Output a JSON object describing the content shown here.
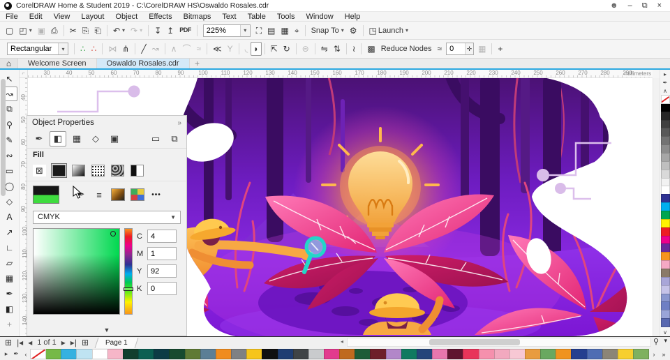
{
  "titlebar": {
    "title": "CorelDRAW Home & Student 2019 - C:\\CorelDRAW HS\\Oswaldo Rosales.cdr",
    "controls": {
      "account": "☻",
      "minimize": "–",
      "restore": "⧉",
      "close": "×"
    }
  },
  "menu": {
    "items": [
      "File",
      "Edit",
      "View",
      "Layout",
      "Object",
      "Effects",
      "Bitmaps",
      "Text",
      "Table",
      "Tools",
      "Window",
      "Help"
    ]
  },
  "toolbar": {
    "zoom_level": "225%",
    "left_buttons": [
      {
        "name": "new-document-button",
        "glyph": "▢"
      },
      {
        "name": "open-button",
        "glyph": "◰",
        "caret": true
      },
      {
        "name": "save-button",
        "glyph": "▣",
        "disabled": true
      },
      {
        "name": "print-button",
        "glyph": "⎙"
      },
      {
        "sep": true
      },
      {
        "name": "cut-button",
        "glyph": "✂"
      },
      {
        "name": "copy-button",
        "glyph": "⎘"
      },
      {
        "name": "paste-button",
        "glyph": "⎗"
      },
      {
        "sep": true
      },
      {
        "name": "undo-button",
        "glyph": "↶",
        "caret": true
      },
      {
        "name": "redo-button",
        "glyph": "↷",
        "caret": true,
        "disabled": true
      },
      {
        "sep": true
      },
      {
        "name": "import-button",
        "glyph": "↧"
      },
      {
        "name": "export-button",
        "glyph": "↥"
      },
      {
        "name": "publish-pdf-button",
        "glyph": "PDF",
        "text": true
      },
      {
        "sep": true
      }
    ],
    "right_buttons": [
      {
        "name": "full-screen-preview-button",
        "glyph": "⛶"
      },
      {
        "name": "show-rulers-button",
        "glyph": "▤"
      },
      {
        "name": "show-grid-button",
        "glyph": "▦"
      },
      {
        "name": "snap-off-button",
        "glyph": "⌖"
      },
      {
        "sep": true
      },
      {
        "name": "snap-to-dropdown",
        "label": "Snap To",
        "caret": true
      },
      {
        "name": "options-button",
        "glyph": "⚙"
      },
      {
        "sep": true
      },
      {
        "name": "launch-dropdown",
        "glyph": "◳",
        "label": "Launch",
        "caret": true
      }
    ]
  },
  "property_bar": {
    "shape_mode": "Rectangular",
    "smoothness_value": "0",
    "buttons": [
      {
        "name": "add-nodes-button",
        "glyph": "∴",
        "color": "#2e9e3f"
      },
      {
        "name": "delete-nodes-button",
        "glyph": "∴",
        "color": "#d23b2e"
      },
      {
        "sep": true
      },
      {
        "name": "join-nodes-button",
        "glyph": "⋈",
        "disabled": true
      },
      {
        "name": "break-nodes-button",
        "glyph": "⋔"
      },
      {
        "sep": true
      },
      {
        "name": "convert-to-line-button",
        "glyph": "╱"
      },
      {
        "name": "convert-to-curve-button",
        "glyph": "↝",
        "disabled": true
      },
      {
        "sep": true
      },
      {
        "name": "cusp-node-button",
        "glyph": "∧",
        "disabled": true
      },
      {
        "name": "smooth-node-button",
        "glyph": "⌒",
        "disabled": true
      },
      {
        "name": "symmetrical-node-button",
        "glyph": "≈",
        "disabled": true
      },
      {
        "sep": true
      },
      {
        "name": "reverse-direction-button",
        "glyph": "≪"
      },
      {
        "name": "extract-subpath-button",
        "glyph": "Y",
        "disabled": true
      },
      {
        "sep": true
      },
      {
        "name": "extend-curve-button",
        "glyph": "◟",
        "disabled": true
      },
      {
        "name": "close-curve-button",
        "glyph": "◗",
        "boxed": true
      },
      {
        "sep": true
      },
      {
        "name": "stretch-nodes-button",
        "glyph": "⇱"
      },
      {
        "name": "rotate-nodes-button",
        "glyph": "↻"
      },
      {
        "sep": true
      },
      {
        "name": "align-nodes-button",
        "glyph": "⊜",
        "disabled": true
      },
      {
        "sep": true
      },
      {
        "name": "reflect-horizontally-button",
        "glyph": "⇋"
      },
      {
        "name": "reflect-vertically-button",
        "glyph": "⇅"
      },
      {
        "sep": true
      },
      {
        "name": "elastic-mode-button",
        "glyph": "≀"
      },
      {
        "sep": true
      },
      {
        "name": "select-all-nodes-button",
        "glyph": "▩"
      },
      {
        "name": "reduce-nodes-button",
        "label": "Reduce Nodes"
      },
      {
        "name": "curve-smoothness-icon",
        "glyph": "≈"
      }
    ],
    "tail_buttons": [
      {
        "name": "snap-grid-button",
        "glyph": "▦",
        "disabled": true
      },
      {
        "sep": true
      },
      {
        "name": "customize-toolbar-button",
        "glyph": "+"
      }
    ]
  },
  "document_tabs": {
    "home_icon": "⌂",
    "tabs": [
      {
        "label": "Welcome Screen",
        "active": false
      },
      {
        "label": "Oswaldo Rosales.cdr",
        "active": true
      }
    ],
    "new_tab": "+"
  },
  "ruler": {
    "unit": "millimeters",
    "h_labels": [
      "30",
      "40",
      "50",
      "60",
      "70",
      "80",
      "90",
      "100",
      "110",
      "120",
      "130",
      "140",
      "150",
      "160",
      "170",
      "180",
      "190",
      "200",
      "210",
      "220",
      "230",
      "240",
      "250",
      "260",
      "270",
      "280",
      "290"
    ],
    "v_labels": [
      "40",
      "50",
      "60",
      "70",
      "80",
      "90",
      "100",
      "110",
      "120",
      "130",
      "140"
    ]
  },
  "toolbox": {
    "tools": [
      {
        "name": "pick-tool",
        "glyph": "↖"
      },
      {
        "name": "shape-tool",
        "glyph": "↝",
        "active": true
      },
      {
        "name": "crop-tool",
        "glyph": "⧉"
      },
      {
        "name": "zoom-tool",
        "glyph": "⚲"
      },
      {
        "name": "freehand-tool",
        "glyph": "✎"
      },
      {
        "name": "artistic-media-tool",
        "glyph": "∾"
      },
      {
        "name": "rectangle-tool",
        "glyph": "▭"
      },
      {
        "name": "ellipse-tool",
        "glyph": "◯"
      },
      {
        "name": "polygon-tool",
        "glyph": "◇"
      },
      {
        "name": "text-tool",
        "glyph": "A"
      },
      {
        "name": "dimension-tool",
        "glyph": "↗"
      },
      {
        "name": "connector-tool",
        "glyph": "∟"
      },
      {
        "name": "drop-shadow-tool",
        "glyph": "▱"
      },
      {
        "name": "transparency-tool",
        "glyph": "▦"
      },
      {
        "name": "eyedropper-tool",
        "glyph": "✒"
      },
      {
        "name": "interactive-fill-tool",
        "glyph": "◧"
      },
      {
        "name": "add-tools-button",
        "glyph": "+",
        "plus": true
      }
    ]
  },
  "docker": {
    "title": "Object Properties",
    "collapse_icon": "»",
    "tabs": [
      {
        "name": "outline-tab",
        "glyph": "✒"
      },
      {
        "name": "fill-tab",
        "glyph": "◧",
        "active": true
      },
      {
        "name": "transparency-tab",
        "glyph": "▦"
      },
      {
        "name": "effect-tab",
        "glyph": "◇"
      },
      {
        "name": "bitmap-tab",
        "glyph": "▣"
      },
      {
        "name": "frame-tab",
        "glyph": "▭",
        "right": true
      },
      {
        "name": "clip-tab",
        "glyph": "⧉",
        "right": true
      }
    ],
    "section_label": "Fill",
    "fill_types": [
      "no-fill",
      "uniform-fill",
      "fountain-fill",
      "pattern-fill",
      "texture-fill",
      "two-color-fill"
    ],
    "fill_active": "uniform-fill",
    "no_fill_glyph": "⊠",
    "color_icons": {
      "eyedropper": "✒",
      "sliders": "≡",
      "more": "•••"
    },
    "color_model": "CMYK",
    "cmyk_rows": [
      {
        "label": "C",
        "value": "4"
      },
      {
        "label": "M",
        "value": "1"
      },
      {
        "label": "Y",
        "value": "92"
      },
      {
        "label": "K",
        "value": "0"
      }
    ],
    "footer_arrow": "▼"
  },
  "status_bar": {
    "buttons": [
      {
        "name": "add-page-start-button",
        "glyph": "⊞"
      },
      {
        "name": "first-page-button",
        "glyph": "|◂"
      },
      {
        "name": "previous-page-button",
        "glyph": "◂"
      },
      {
        "name": "page-indicator",
        "label": "1 of 1",
        "static": true
      },
      {
        "name": "next-page-button",
        "glyph": "▸"
      },
      {
        "name": "last-page-button",
        "glyph": "▸|"
      },
      {
        "name": "add-page-end-button",
        "glyph": "⊞"
      }
    ],
    "page_tab": "Page 1",
    "scroll_left_arrow": "◂",
    "zoom_icon": "⚲",
    "collapse_icon": "▾"
  },
  "palettes": {
    "right": [
      "none",
      "#000000",
      "#262626",
      "#404040",
      "#595959",
      "#737373",
      "#8c8c8c",
      "#a6a6a6",
      "#bfbfbf",
      "#d9d9d9",
      "#f2f2f2",
      "#ffffff",
      "#2e3192",
      "#00aeef",
      "#00a651",
      "#fff200",
      "#ed1c24",
      "#ec008c",
      "#68299a",
      "#f7941d",
      "#f5a9c4",
      "#8a7a68",
      "#a9a6d8",
      "#c6c3e8",
      "#8a97cf",
      "#6e7fc4",
      "#9aa5d8",
      "#5868b0"
    ],
    "right_controls": {
      "flyout": "▸",
      "eyedropper": "✒",
      "up": "∧",
      "down": "∨"
    },
    "document": [
      "none",
      "#76b947",
      "#35b1e0",
      "#bfe3f2",
      "#ffffff",
      "#f6b6c8",
      "#123f2e",
      "#0c5f52",
      "#0d3b45",
      "#174a2f",
      "#5f7a34",
      "#5b7f96",
      "#f08c1e",
      "#7f8184",
      "#f6c51c",
      "#101010",
      "#1f3d72",
      "#3f4346",
      "#c9cbcd",
      "#e23a8e",
      "#bf6a1f",
      "#1d5c37",
      "#6e1f2a",
      "#b287c9",
      "#0f7a60",
      "#24457a",
      "#e877ae",
      "#5f1430",
      "#e8345a",
      "#f590ad",
      "#f2a9bf",
      "#f7c8d4",
      "#e89c3f",
      "#69a860",
      "#f0931f",
      "#243f8f",
      "#4f6db3",
      "#8c8577",
      "#f7cf2e",
      "#7fb15f"
    ],
    "document_controls": {
      "flyout": "▸",
      "eyedropper": "✒",
      "left": "‹",
      "right": "›",
      "more": "»"
    }
  },
  "accent_colors": {
    "doc_underline": "#2ba8e0",
    "active_tab_bg": "#d4e9f8",
    "canvas_purple": "#8d2ae6",
    "glow_orange": "#ff8d4d",
    "leaf_pink": "#e22574"
  }
}
